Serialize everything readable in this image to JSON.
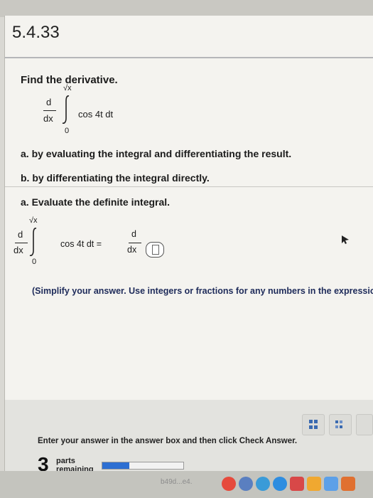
{
  "question": {
    "number": "5.4.33",
    "prompt": "Find the derivative.",
    "expression": {
      "d": "d",
      "dx": "dx",
      "upper_limit": "√x",
      "lower_limit": "0",
      "integrand": "cos 4t dt"
    },
    "parts": [
      {
        "label": "a. by evaluating the integral and differentiating the result."
      },
      {
        "label": "b. by differentiating the integral directly."
      }
    ]
  },
  "part_a": {
    "heading": "a. Evaluate the definite integral.",
    "expression": {
      "d": "d",
      "dx": "dx",
      "upper_limit": "√x",
      "lower_limit": "0",
      "integrand": "cos 4t dt =",
      "rhs_d": "d",
      "rhs_dx": "dx"
    },
    "instruction": "(Simplify your answer. Use integers or fractions for any numbers in the expression."
  },
  "footer": {
    "hint": "Enter your answer in the answer box and then click Check Answer.",
    "parts_count": "3",
    "parts_label_1": "parts",
    "parts_label_2": "remaining",
    "progress_fraction": 0.33,
    "taskbar_text": "b49d...e4."
  },
  "colors": {
    "accent": "#2d6fd2",
    "note_text": "#1e2b5a"
  },
  "icons": [
    "toolbar-grid-icon",
    "toolbar-matrix-icon",
    "cursor-icon"
  ]
}
